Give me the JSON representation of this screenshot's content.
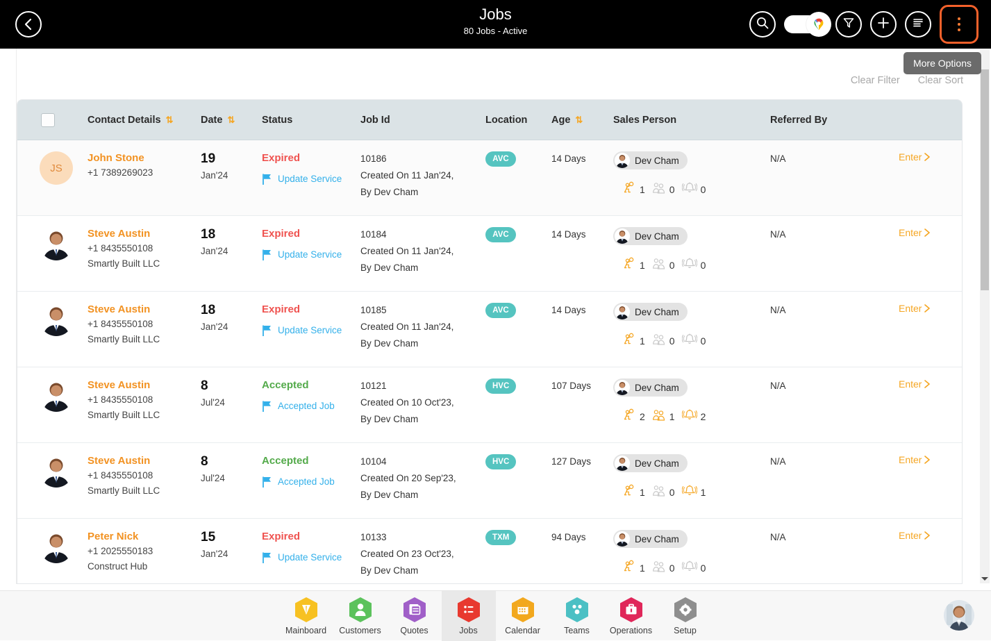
{
  "header": {
    "title": "Jobs",
    "subtitle": "80 Jobs - Active",
    "back_icon": "chevron-left-icon",
    "actions": [
      {
        "name": "search-icon",
        "label": "Search"
      },
      {
        "name": "map-toggle",
        "label": "Map View"
      },
      {
        "name": "filter-icon",
        "label": "Filter"
      },
      {
        "name": "add-icon",
        "label": "Add"
      },
      {
        "name": "list-icon",
        "label": "List View"
      },
      {
        "name": "more-options-icon",
        "label": "More Options"
      }
    ]
  },
  "tooltip": {
    "text": "More Options"
  },
  "subbar": {
    "clear_filter": "Clear Filter",
    "clear_sort": "Clear Sort"
  },
  "table": {
    "columns": [
      {
        "key": "select",
        "label": "",
        "sortable": false
      },
      {
        "key": "contact",
        "label": "Contact Details",
        "sortable": true
      },
      {
        "key": "date",
        "label": "Date",
        "sortable": true
      },
      {
        "key": "status",
        "label": "Status",
        "sortable": false
      },
      {
        "key": "jobid",
        "label": "Job Id",
        "sortable": false
      },
      {
        "key": "location",
        "label": "Location",
        "sortable": false
      },
      {
        "key": "age",
        "label": "Age",
        "sortable": true
      },
      {
        "key": "sales",
        "label": "Sales Person",
        "sortable": false
      },
      {
        "key": "referred",
        "label": "Referred By",
        "sortable": false
      },
      {
        "key": "enter",
        "label": "",
        "sortable": false
      }
    ],
    "enter_label": "Enter",
    "rows": [
      {
        "avatar_type": "initials",
        "avatar_initials": "JS",
        "name": "John Stone",
        "phone": "+1 7389269023",
        "company": "",
        "date_day": "19",
        "date_month": "Jan'24",
        "status": "Expired",
        "status_kind": "expired",
        "status_action": "Update Service",
        "job_id": "10186",
        "job_created": "Created On 11 Jan'24,",
        "job_by": "By Dev Cham",
        "location": "AVC",
        "age": "14 Days",
        "sales_person": "Dev Cham",
        "count_tech": "1",
        "count_crew": "0",
        "count_alert": "0",
        "referred_by": "N/A"
      },
      {
        "avatar_type": "photo",
        "avatar_initials": "",
        "name": "Steve Austin",
        "phone": "+1 8435550108",
        "company": "Smartly Built LLC",
        "date_day": "18",
        "date_month": "Jan'24",
        "status": "Expired",
        "status_kind": "expired",
        "status_action": "Update Service",
        "job_id": "10184",
        "job_created": "Created On 11 Jan'24,",
        "job_by": "By Dev Cham",
        "location": "AVC",
        "age": "14 Days",
        "sales_person": "Dev Cham",
        "count_tech": "1",
        "count_crew": "0",
        "count_alert": "0",
        "referred_by": "N/A"
      },
      {
        "avatar_type": "photo",
        "avatar_initials": "",
        "name": "Steve Austin",
        "phone": "+1 8435550108",
        "company": "Smartly Built LLC",
        "date_day": "18",
        "date_month": "Jan'24",
        "status": "Expired",
        "status_kind": "expired",
        "status_action": "Update Service",
        "job_id": "10185",
        "job_created": "Created On 11 Jan'24,",
        "job_by": "By Dev Cham",
        "location": "AVC",
        "age": "14 Days",
        "sales_person": "Dev Cham",
        "count_tech": "1",
        "count_crew": "0",
        "count_alert": "0",
        "referred_by": "N/A"
      },
      {
        "avatar_type": "photo",
        "avatar_initials": "",
        "name": "Steve Austin",
        "phone": "+1 8435550108",
        "company": "Smartly Built LLC",
        "date_day": "8",
        "date_month": "Jul'24",
        "status": "Accepted",
        "status_kind": "accepted",
        "status_action": "Accepted Job",
        "job_id": "10121",
        "job_created": "Created On 10 Oct'23,",
        "job_by": "By Dev Cham",
        "location": "HVC",
        "age": "107 Days",
        "sales_person": "Dev Cham",
        "count_tech": "2",
        "count_crew": "1",
        "count_alert": "2",
        "referred_by": "N/A"
      },
      {
        "avatar_type": "photo",
        "avatar_initials": "",
        "name": "Steve Austin",
        "phone": "+1 8435550108",
        "company": "Smartly Built LLC",
        "date_day": "8",
        "date_month": "Jul'24",
        "status": "Accepted",
        "status_kind": "accepted",
        "status_action": "Accepted Job",
        "job_id": "10104",
        "job_created": "Created On 20 Sep'23,",
        "job_by": "By Dev Cham",
        "location": "HVC",
        "age": "127 Days",
        "sales_person": "Dev Cham",
        "count_tech": "1",
        "count_crew": "0",
        "count_alert": "1",
        "referred_by": "N/A"
      },
      {
        "avatar_type": "photo",
        "avatar_initials": "",
        "name": "Peter Nick",
        "phone": "+1 2025550183",
        "company": "Construct Hub",
        "date_day": "15",
        "date_month": "Jan'24",
        "status": "Expired",
        "status_kind": "expired",
        "status_action": "Update Service",
        "job_id": "10133",
        "job_created": "Created On 23 Oct'23,",
        "job_by": "By Dev Cham",
        "location": "TXM",
        "age": "94 Days",
        "sales_person": "Dev Cham",
        "count_tech": "1",
        "count_crew": "0",
        "count_alert": "0",
        "referred_by": "N/A"
      }
    ]
  },
  "bottom_nav": {
    "active": "Jobs",
    "items": [
      {
        "label": "Mainboard",
        "icon": "mainboard-icon",
        "color": "#f7c122"
      },
      {
        "label": "Customers",
        "icon": "customers-icon",
        "color": "#5cc25c"
      },
      {
        "label": "Quotes",
        "icon": "quotes-icon",
        "color": "#a05fc8"
      },
      {
        "label": "Jobs",
        "icon": "jobs-icon",
        "color": "#e8392f"
      },
      {
        "label": "Calendar",
        "icon": "calendar-icon",
        "color": "#f2a81e"
      },
      {
        "label": "Teams",
        "icon": "teams-icon",
        "color": "#4cc0c4"
      },
      {
        "label": "Operations",
        "icon": "operations-icon",
        "color": "#e0275a"
      },
      {
        "label": "Setup",
        "icon": "setup-icon",
        "color": "#8e8e8e"
      }
    ]
  },
  "colors": {
    "accent_orange": "#f29222",
    "header_bg": "#000000",
    "highlight_border": "#f4612b",
    "expired": "#ef5350",
    "accepted": "#53aa4a",
    "link_blue": "#33b0ea",
    "badge_teal": "#55c4c0",
    "thead_bg": "#dbe3e6"
  }
}
